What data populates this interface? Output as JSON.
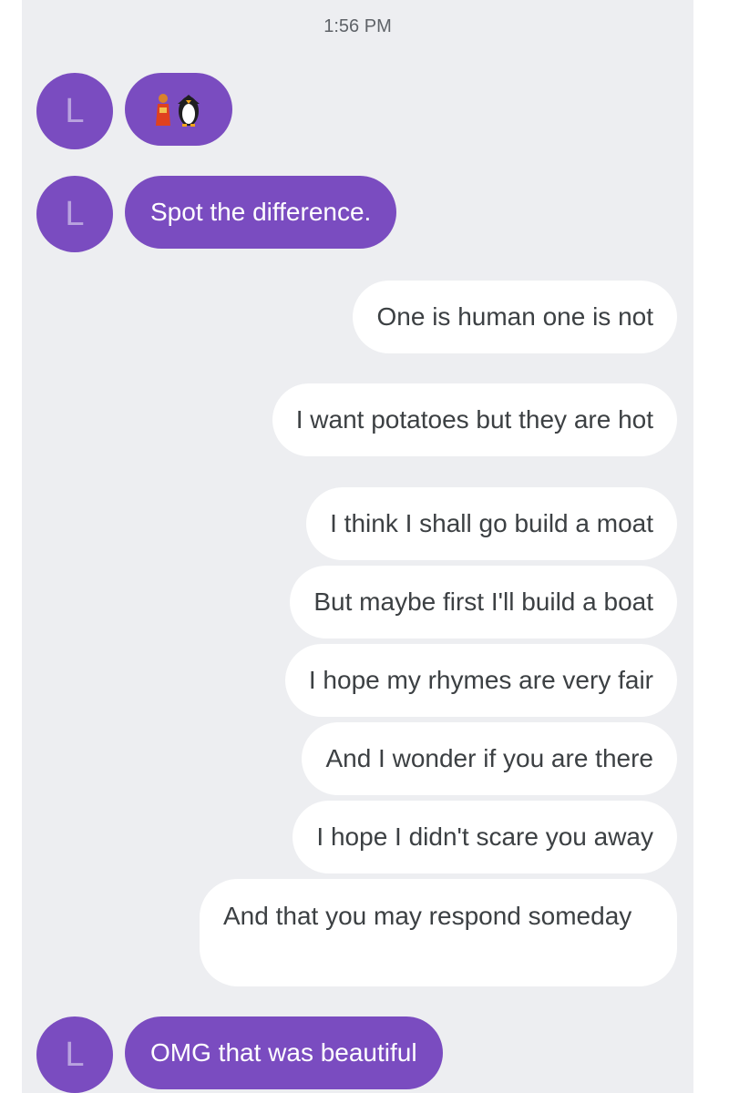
{
  "status": {
    "time": "1:56 PM"
  },
  "contact": {
    "initial": "L"
  },
  "messages": [
    {
      "direction": "incoming",
      "type": "emoji",
      "icon": "person-and-penguin-emoji-icon"
    },
    {
      "direction": "incoming",
      "text": "Spot the difference."
    },
    {
      "direction": "outgoing",
      "text": "One is human one is not"
    },
    {
      "direction": "outgoing",
      "text": "I want potatoes but they are hot"
    },
    {
      "direction": "outgoing",
      "text": "I think I shall go build a moat"
    },
    {
      "direction": "outgoing",
      "text": "But maybe first I'll build a boat"
    },
    {
      "direction": "outgoing",
      "text": "I hope my rhymes are very fair"
    },
    {
      "direction": "outgoing",
      "text": "And I wonder if you are there"
    },
    {
      "direction": "outgoing",
      "text": "I hope I didn't scare you away"
    },
    {
      "direction": "outgoing",
      "text": "And that you may respond someday"
    },
    {
      "direction": "incoming",
      "text": "OMG that was beautiful"
    }
  ],
  "colors": {
    "incoming_bubble": "#7a4cc0",
    "outgoing_bubble": "#ffffff",
    "background": "#edeef1",
    "outgoing_text": "#3c4043"
  }
}
